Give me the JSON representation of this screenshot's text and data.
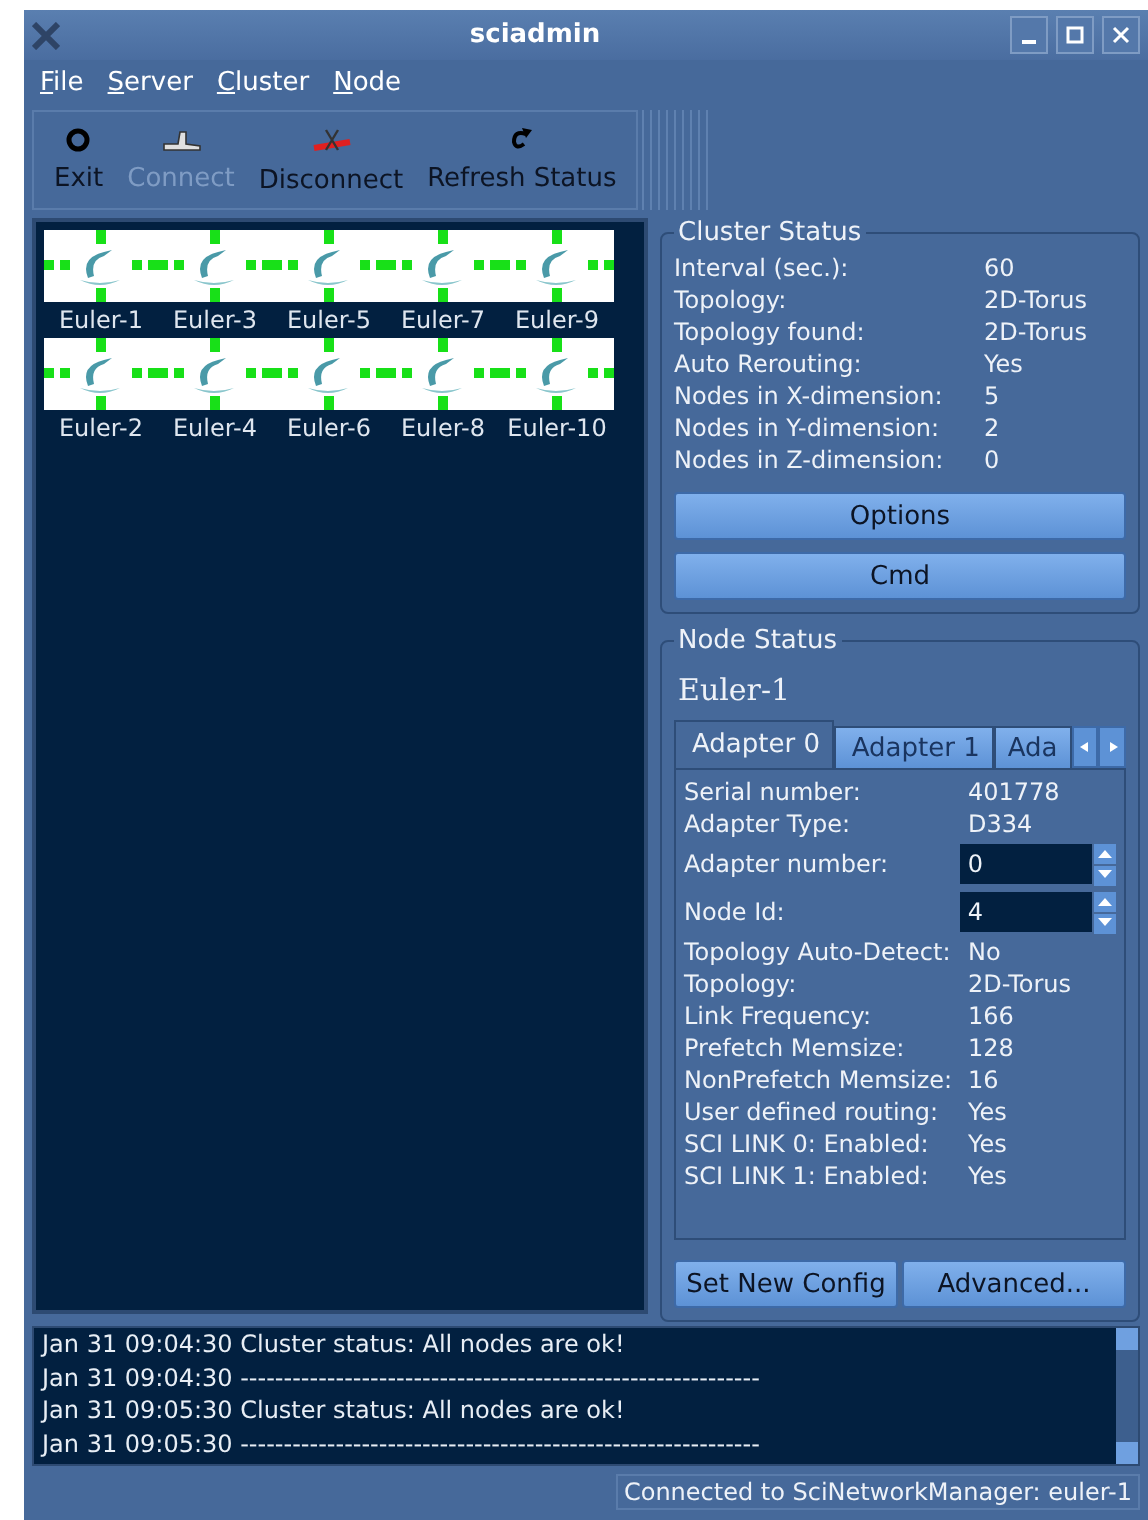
{
  "window": {
    "title": "sciadmin"
  },
  "menu": [
    {
      "label": "File"
    },
    {
      "label": "Server"
    },
    {
      "label": "Cluster"
    },
    {
      "label": "Node"
    }
  ],
  "toolbar": [
    {
      "label": "Exit",
      "kind": "exit",
      "disabled": false
    },
    {
      "label": "Connect",
      "kind": "connect",
      "disabled": true
    },
    {
      "label": "Disconnect",
      "kind": "disconnect",
      "disabled": false
    },
    {
      "label": "Refresh Status",
      "kind": "refresh",
      "disabled": false
    }
  ],
  "nodes": [
    [
      {
        "label": "Euler-1"
      },
      {
        "label": "Euler-3"
      },
      {
        "label": "Euler-5"
      },
      {
        "label": "Euler-7"
      },
      {
        "label": "Euler-9"
      }
    ],
    [
      {
        "label": "Euler-2"
      },
      {
        "label": "Euler-4"
      },
      {
        "label": "Euler-6"
      },
      {
        "label": "Euler-8"
      },
      {
        "label": "Euler-10"
      }
    ]
  ],
  "cluster_status": {
    "title": "Cluster Status",
    "fields": [
      {
        "label": "Interval (sec.):",
        "value": "60"
      },
      {
        "label": "Topology:",
        "value": "2D-Torus"
      },
      {
        "label": "Topology found:",
        "value": "2D-Torus"
      },
      {
        "label": "Auto Rerouting:",
        "value": "Yes"
      },
      {
        "label": "Nodes in X-dimension:",
        "value": "5"
      },
      {
        "label": "Nodes in Y-dimension:",
        "value": "2"
      },
      {
        "label": "Nodes in Z-dimension:",
        "value": "0"
      }
    ],
    "buttons": [
      "Options",
      "Cmd"
    ]
  },
  "node_status": {
    "title": "Node Status",
    "node": "Euler-1",
    "tabs": [
      {
        "label": "Adapter 0",
        "selected": true
      },
      {
        "label": "Adapter 1",
        "selected": false
      },
      {
        "label": "Ada",
        "selected": false
      }
    ],
    "fields": [
      {
        "label": "Serial number:",
        "value": "401778",
        "kind": "text"
      },
      {
        "label": "Adapter Type:",
        "value": "D334",
        "kind": "text"
      },
      {
        "label": "Adapter number:",
        "value": "0",
        "kind": "spin"
      },
      {
        "label": "Node Id:",
        "value": "4",
        "kind": "spin"
      },
      {
        "label": "Topology Auto-Detect:",
        "value": "No",
        "kind": "text"
      },
      {
        "label": "Topology:",
        "value": "2D-Torus",
        "kind": "text"
      },
      {
        "label": "Link Frequency:",
        "value": "166",
        "kind": "text"
      },
      {
        "label": "Prefetch Memsize:",
        "value": "128",
        "kind": "text"
      },
      {
        "label": "NonPrefetch Memsize:",
        "value": "16",
        "kind": "text"
      },
      {
        "label": "User defined routing:",
        "value": "Yes",
        "kind": "text"
      },
      {
        "label": "SCI LINK 0: Enabled:",
        "value": "Yes",
        "kind": "text"
      },
      {
        "label": "SCI LINK 1: Enabled:",
        "value": "Yes",
        "kind": "text"
      }
    ],
    "buttons": [
      "Set New Config",
      "Advanced..."
    ]
  },
  "log": [
    "Jan 31 09:04:30 Cluster status: All nodes are ok!",
    "Jan 31 09:04:30 ------------------------------------------------------------",
    "Jan 31 09:05:30 Cluster status: All nodes are ok!",
    "Jan 31 09:05:30 ------------------------------------------------------------"
  ],
  "status_bar": "Connected to SciNetworkManager: euler-1"
}
